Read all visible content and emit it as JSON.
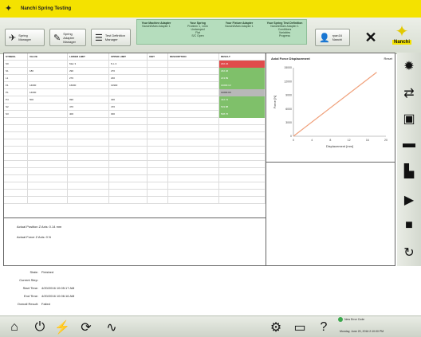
{
  "app": {
    "title": "Nanchi Spring Testing",
    "brand": "Nanchi",
    "brand_color": "#f4e200"
  },
  "toolbar": {
    "buttons": [
      {
        "label": "Spring Manager",
        "icon": "spring-icon"
      },
      {
        "label": "Spring Adapter Manager",
        "icon": "wrench-icon"
      },
      {
        "label": "Test Definition Manager",
        "icon": "list-icon"
      }
    ],
    "info_boxes": [
      {
        "head": "Your Machine Adapter",
        "value": "Nanchi/Main Adapter 1"
      },
      {
        "head": "Your Spring",
        "value": "Problem 1, 1mm",
        "sub": [
          "Undamped",
          "Flat",
          "S/C Open"
        ]
      },
      {
        "head": "Your Fixture Adapter",
        "value": "Nanchi/Main Adapter 1"
      },
      {
        "head": "Your Spring Test Definition",
        "value": "Nanchi/Main Adapter 1",
        "sub": [
          "Conditions",
          "Variables",
          "Progress"
        ]
      }
    ],
    "user_label": "ryan16 Nanchi"
  },
  "table": {
    "headers": [
      "SYMBOL",
      "VALUE",
      "LOWER LIMIT",
      "UPPER LIMIT",
      "UNIT",
      "DESCRIPTION",
      "RESULT"
    ],
    "rows": [
      {
        "c": [
          "S0",
          "",
          "Max 3",
          "N.L.3",
          "",
          "",
          "202.34"
        ],
        "s": "red"
      },
      {
        "c": [
          "S1",
          "180",
          "290",
          "270",
          "",
          "",
          "232.46"
        ],
        "s": "green"
      },
      {
        "c": [
          "L1",
          "",
          "270",
          "230",
          "",
          "",
          "213.89"
        ],
        "s": "green"
      },
      {
        "c": [
          "F1",
          "14000",
          "16000",
          "13900",
          "",
          "",
          "14000.13"
        ],
        "s": "green"
      },
      {
        "c": [
          "P1",
          "14000",
          "",
          "",
          "",
          "",
          "14000.00"
        ],
        "s": "gray"
      },
      {
        "c": [
          "P4",
          "500",
          "990",
          "400",
          "",
          "",
          "412.72"
        ],
        "s": "green"
      },
      {
        "c": [
          "S2",
          "",
          "470",
          "470",
          "",
          "",
          "519.88"
        ],
        "s": "green"
      },
      {
        "c": [
          "S3",
          "",
          "400",
          "300",
          "",
          "",
          "508.76"
        ],
        "s": "green"
      }
    ],
    "status_colors": {
      "red": "#e04b4b",
      "green": "#7fc06a",
      "gray": "#b8b8b8"
    }
  },
  "actual": {
    "position": "Actual Position Z Axis: 0.14 mm",
    "force": "Actual Force Z Axis: 0 N"
  },
  "chart_data": {
    "type": "line",
    "title": "Axial Force Displacement",
    "reset_label": "Reset",
    "xlabel": "Displacement [mm]",
    "ylabel": "Force [N]",
    "x": [
      0,
      18
    ],
    "series": [
      {
        "values": [
          0,
          14000
        ]
      }
    ],
    "xlim": [
      0,
      20
    ],
    "ylim": [
      0,
      15000
    ],
    "xticks": [
      "0",
      "4",
      "8",
      "12",
      "16",
      "20"
    ],
    "yticks": [
      "0",
      "3000",
      "6000",
      "9000",
      "12000",
      "15000"
    ],
    "line_color": "#f0a07a",
    "grid": false
  },
  "sidebar": {
    "icons": [
      "gear-icon",
      "transfer-icon",
      "save-icon",
      "fixture-icon",
      "clamp-icon",
      "play-icon",
      "stop-icon",
      "reset-icon"
    ]
  },
  "status": {
    "rows": [
      {
        "label": "State:",
        "value": "Finished"
      },
      {
        "label": "Current Step:",
        "value": ""
      },
      {
        "label": "Start Time:",
        "value": "4/20/2016 10:05:17 AM"
      },
      {
        "label": "End Time:",
        "value": "4/20/2016 10:06:16 AM"
      },
      {
        "label": "Overall Result:",
        "value": "Failed"
      }
    ]
  },
  "bottombar": {
    "note": "New Error Code",
    "datetime": "Monday, June 20, 2016 2:10:00 PM"
  }
}
